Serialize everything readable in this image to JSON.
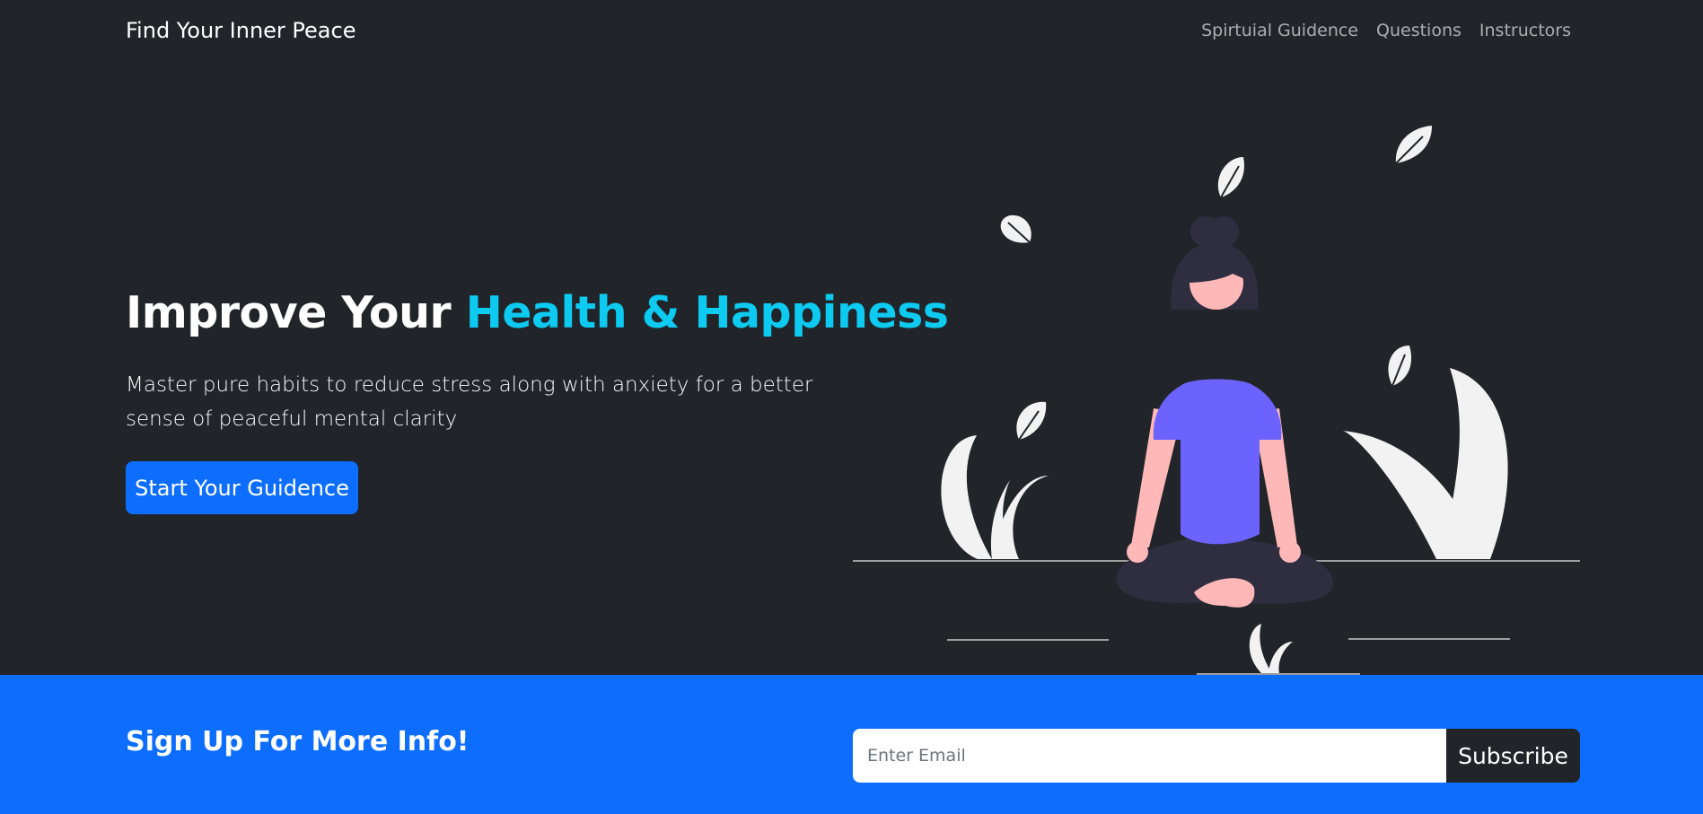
{
  "navbar": {
    "brand": "Find Your Inner Peace",
    "links": [
      "Spirtuial Guidence",
      "Questions",
      "Instructors"
    ]
  },
  "hero": {
    "title_prefix": "Improve Your",
    "title_accent": "Health & Happiness",
    "lead": "Master pure habits to reduce stress along with anxiety for a better sense of peaceful mental clarity",
    "cta_label": "Start Your Guidence",
    "illustration_icon": "meditating-woman-illustration"
  },
  "newsletter": {
    "heading": "Sign Up For More Info!",
    "email_placeholder": "Enter Email",
    "email_value": "",
    "subscribe_label": "Subscribe"
  },
  "colors": {
    "background": "#212529",
    "accent": "#0dcaf0",
    "primary": "#0d6efd",
    "shirt": "#6c63ff",
    "skin": "#ffb8b8",
    "leaf": "#f2f2f2"
  }
}
